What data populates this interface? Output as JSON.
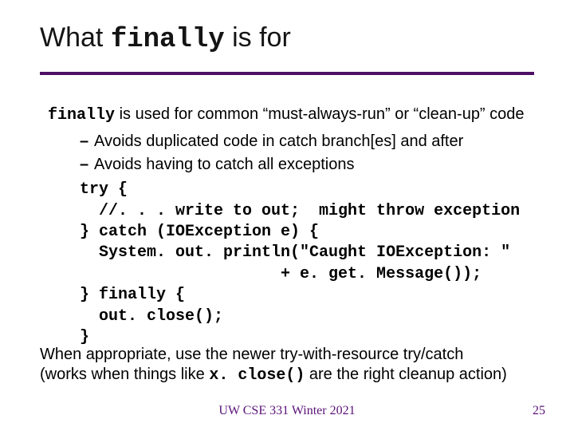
{
  "title": {
    "pre": "What ",
    "code": "finally",
    "post": " is for"
  },
  "intro": {
    "code": "finally",
    "rest": " is used for common “must-always-run” or “clean-up” code"
  },
  "bullets": [
    "Avoids duplicated code in catch branch[es] and after",
    "Avoids having to catch all exceptions"
  ],
  "code": {
    "l1": "try {",
    "l2": "  //. . . write to out;  might throw exception",
    "l3": "} catch (IOException e) {",
    "l4": "  System. out. println(\"Caught IOException: \"",
    "l5": "                     + e. get. Message());",
    "l6": "} finally {",
    "l7": "  out. close();",
    "l8": "}"
  },
  "closing": {
    "l1": "When appropriate, use the newer try-with-resource try/catch",
    "l2a": "(works when things like ",
    "l2code": "x. close()",
    "l2b": " are the right cleanup action)"
  },
  "footer": {
    "center": "UW CSE 331 Winter 2021",
    "pageno": "25"
  }
}
